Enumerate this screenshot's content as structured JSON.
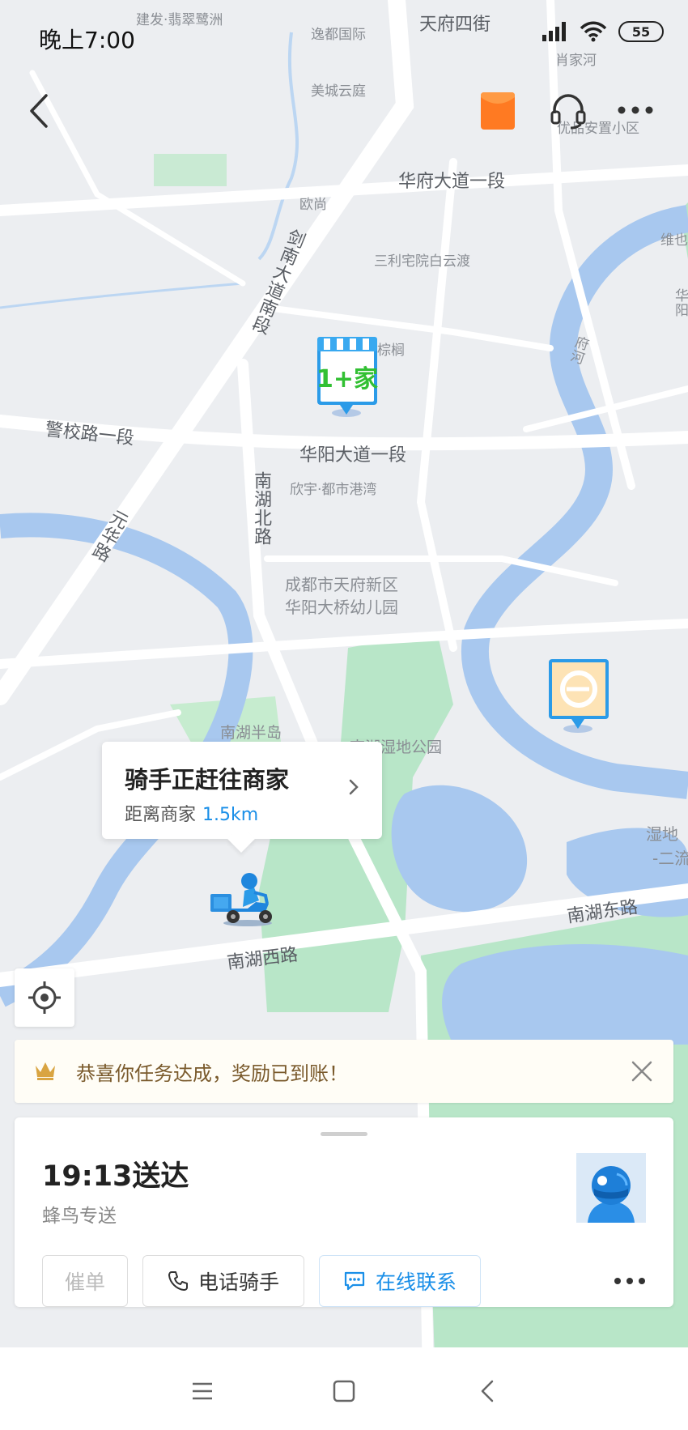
{
  "status_bar": {
    "time": "晚上7:00",
    "battery": "55"
  },
  "top_actions": {
    "back_icon": "chevron-left-icon",
    "redpacket_icon": "red-packet-icon",
    "support_icon": "headset-icon",
    "more_icon": "more-horizontal-icon"
  },
  "map": {
    "labels": [
      "建发·翡翠鹭洲",
      "天府四街",
      "逸都国际",
      "肖家河",
      "美城云庭",
      "优品安置小区",
      "华府大道一段",
      "欧尚",
      "维也",
      "剑南大道南段",
      "三利宅院白云渡",
      "府河",
      "华阳",
      "棕榈",
      "警校路一段",
      "华阳大道一段",
      "欣宇·都市港湾",
      "南湖北路",
      "元华路",
      "成都市天府新区",
      "华阳大桥幼儿园",
      "南湖半岛",
      "南湖湿地公园",
      "湿地",
      "-二流",
      "南湖东路",
      "南湖西路"
    ],
    "merchant_marker_text": "1+家"
  },
  "rider_callout": {
    "title": "骑手正赶往商家",
    "distance_prefix": "距离商家",
    "distance": "1.5km"
  },
  "reward_banner": {
    "text": "恭喜你任务达成，奖励已到账！"
  },
  "order_card": {
    "eta": "19:13送达",
    "service": "蜂鸟专送",
    "buttons": {
      "urge": "催单",
      "call": "电话骑手",
      "online": "在线联系"
    }
  },
  "colors": {
    "accent": "#1a8fe8",
    "water": "#a8c8ef",
    "park": "#b8e6c8",
    "reward_text": "#7a5a2c"
  }
}
